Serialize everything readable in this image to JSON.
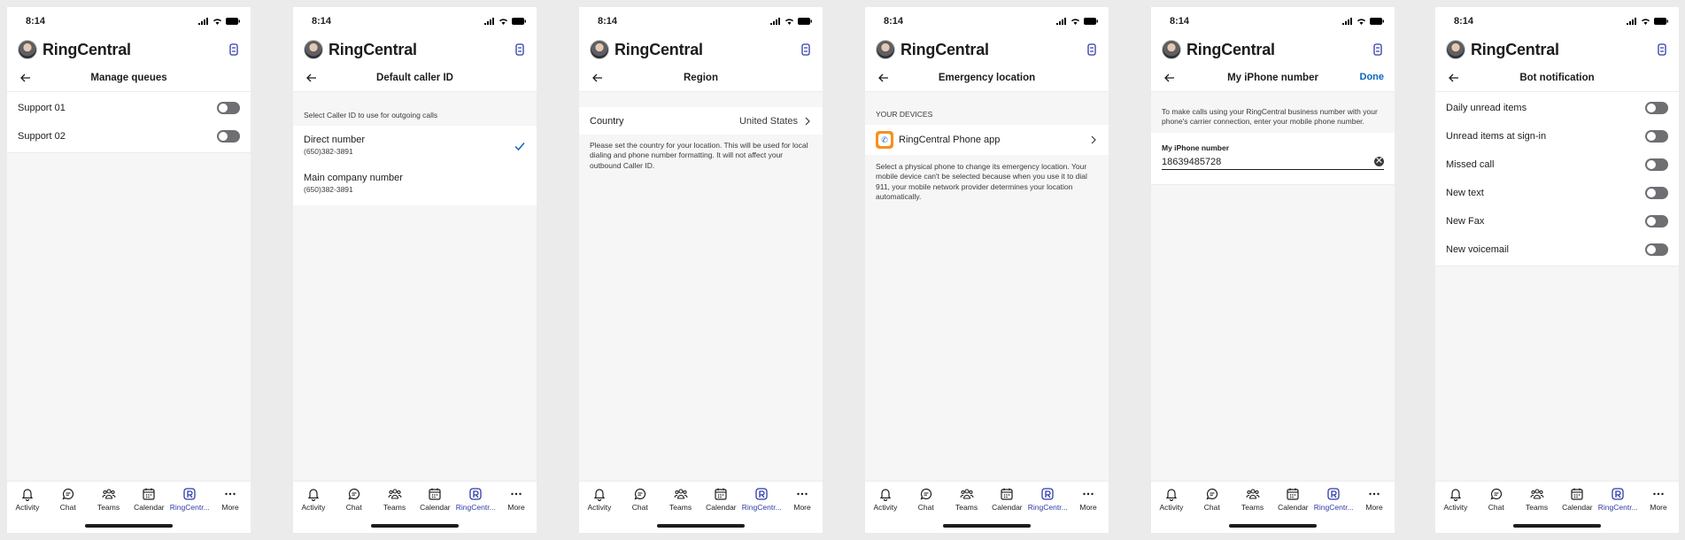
{
  "status": {
    "time": "8:14"
  },
  "app": {
    "brand": "RingCentral"
  },
  "tabs": [
    "Activity",
    "Chat",
    "Teams",
    "Calendar",
    "RingCentr...",
    "More"
  ],
  "accent": "#2f3aa6",
  "screens": {
    "queues": {
      "title": "Manage queues",
      "items": [
        "Support 01",
        "Support 02"
      ]
    },
    "caller_id": {
      "title": "Default caller ID",
      "section": "Select Caller ID to use for outgoing calls",
      "options": [
        {
          "label": "Direct number",
          "number": "(650)382-3891",
          "selected": true
        },
        {
          "label": "Main company number",
          "number": "(650)382-3891",
          "selected": false
        }
      ]
    },
    "region": {
      "title": "Region",
      "row_label": "Country",
      "row_value": "United States",
      "note": "Please set the country for your location. This will be used for local dialing and phone number formatting. It will not affect your outbound Caller ID."
    },
    "emergency": {
      "title": "Emergency location",
      "section": "YOUR DEVICES",
      "device": "RingCentral Phone app",
      "note": "Select a physical phone to change its emergency location. Your mobile device can't be selected because when you use it to dial 911, your mobile network provider determines your location automatically."
    },
    "iphone": {
      "title": "My iPhone number",
      "done": "Done",
      "note": "To make calls using your RingCentral business number with your phone's carrier connection, enter your mobile phone number.",
      "field_label": "My iPhone number",
      "field_value": "18639485728"
    },
    "bot": {
      "title": "Bot notification",
      "items": [
        "Daily unread items",
        "Unread items at sign-in",
        "Missed call",
        "New text",
        "New Fax",
        "New voicemail"
      ]
    }
  }
}
